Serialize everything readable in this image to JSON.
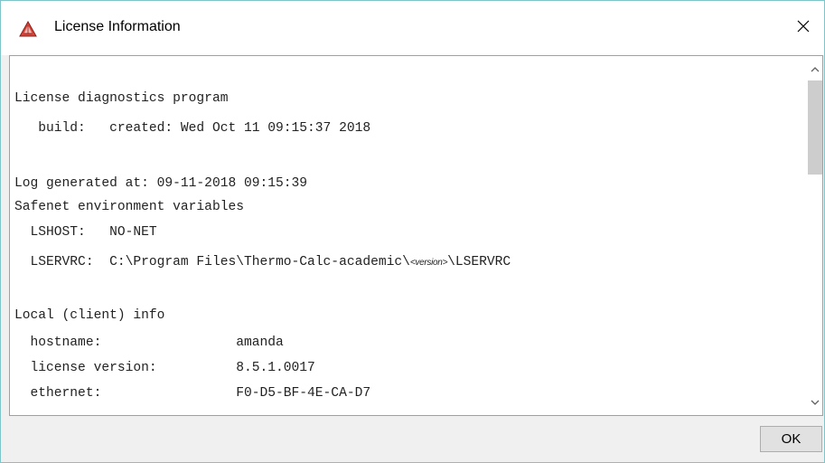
{
  "window": {
    "title": "License Information",
    "title_icon": "thermo-calc-triangle-icon",
    "close_icon": "close-icon"
  },
  "log": {
    "lines": [
      "License diagnostics program",
      "   build:   created: Wed Oct 11 09:15:37 2018",
      "Log generated at: 09-11-2018 09:15:39",
      "Safenet environment variables",
      "  LSHOST:   NO-NET",
      "  LSERVRC:  C:\\Program Files\\Thermo-Calc-academic\\",
      "Local (client) info",
      "  hostname:                 amanda",
      "  license version:          8.5.1.0017",
      "  ethernet:                 F0-D5-BF-4E-CA-D7"
    ],
    "lserv_tag": "<version>",
    "lserv_suffix": "\\LSERVRC"
  },
  "scrollbar": {
    "position": 0.0
  },
  "buttons": {
    "ok": "OK"
  },
  "colors": {
    "border_accent": "#7fc4c9",
    "icon_red": "#cc3a2f"
  }
}
